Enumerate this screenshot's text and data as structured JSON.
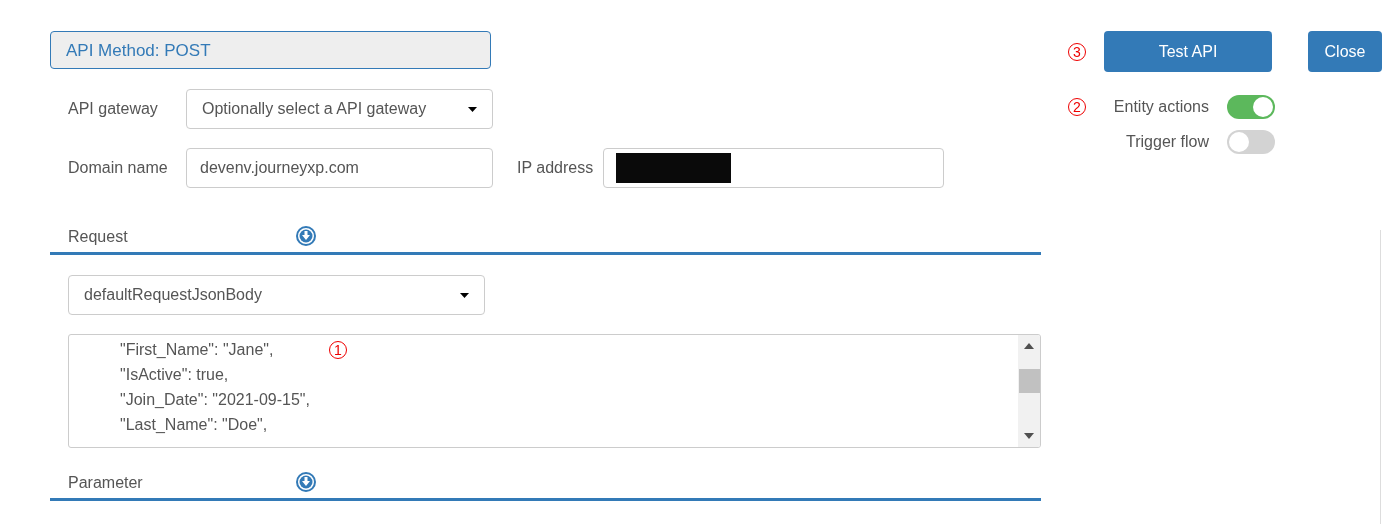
{
  "method_banner": "API Method: POST",
  "api_gateway": {
    "label": "API gateway",
    "placeholder": "Optionally select a API gateway"
  },
  "domain_name": {
    "label": "Domain name",
    "value": "devenv.journeyxp.com"
  },
  "ip_address": {
    "label": "IP address",
    "redacted": true
  },
  "buttons": [
    {
      "label": "Test API",
      "marker": "3"
    },
    {
      "label": "Close"
    }
  ],
  "toggles": [
    {
      "label": "Entity actions",
      "on": true,
      "marker": "2"
    },
    {
      "label": "Trigger flow",
      "on": false
    }
  ],
  "request": {
    "title": "Request",
    "body_select": "defaultRequestJsonBody",
    "marker": "1",
    "lines": [
      "\"First_Name\": \"Jane\",",
      "\"IsActive\": true,",
      "\"Join_Date\": \"2021-09-15\",",
      "\"Last_Name\": \"Doe\","
    ]
  },
  "parameter": {
    "title": "Parameter"
  }
}
